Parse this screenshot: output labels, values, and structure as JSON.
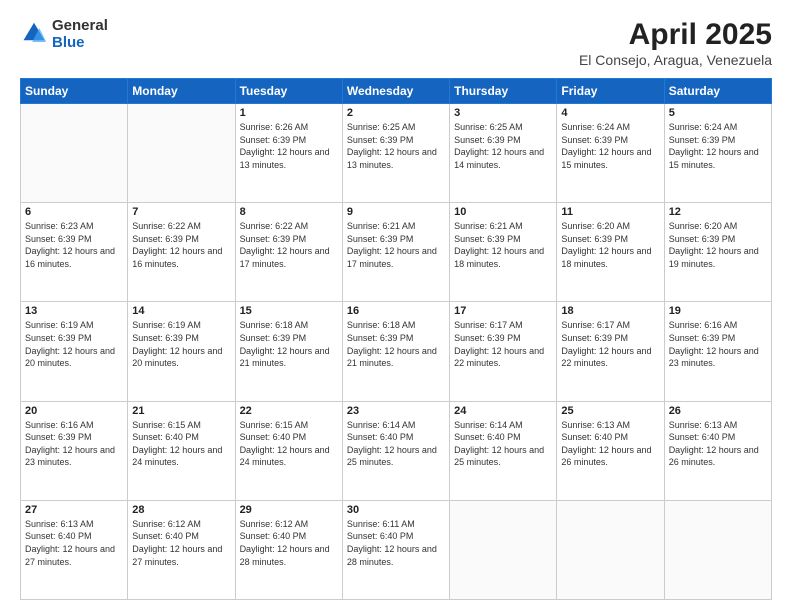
{
  "logo": {
    "general": "General",
    "blue": "Blue"
  },
  "header": {
    "month": "April 2025",
    "location": "El Consejo, Aragua, Venezuela"
  },
  "weekdays": [
    "Sunday",
    "Monday",
    "Tuesday",
    "Wednesday",
    "Thursday",
    "Friday",
    "Saturday"
  ],
  "weeks": [
    [
      {
        "num": "",
        "info": ""
      },
      {
        "num": "",
        "info": ""
      },
      {
        "num": "1",
        "info": "Sunrise: 6:26 AM\nSunset: 6:39 PM\nDaylight: 12 hours and 13 minutes."
      },
      {
        "num": "2",
        "info": "Sunrise: 6:25 AM\nSunset: 6:39 PM\nDaylight: 12 hours and 13 minutes."
      },
      {
        "num": "3",
        "info": "Sunrise: 6:25 AM\nSunset: 6:39 PM\nDaylight: 12 hours and 14 minutes."
      },
      {
        "num": "4",
        "info": "Sunrise: 6:24 AM\nSunset: 6:39 PM\nDaylight: 12 hours and 15 minutes."
      },
      {
        "num": "5",
        "info": "Sunrise: 6:24 AM\nSunset: 6:39 PM\nDaylight: 12 hours and 15 minutes."
      }
    ],
    [
      {
        "num": "6",
        "info": "Sunrise: 6:23 AM\nSunset: 6:39 PM\nDaylight: 12 hours and 16 minutes."
      },
      {
        "num": "7",
        "info": "Sunrise: 6:22 AM\nSunset: 6:39 PM\nDaylight: 12 hours and 16 minutes."
      },
      {
        "num": "8",
        "info": "Sunrise: 6:22 AM\nSunset: 6:39 PM\nDaylight: 12 hours and 17 minutes."
      },
      {
        "num": "9",
        "info": "Sunrise: 6:21 AM\nSunset: 6:39 PM\nDaylight: 12 hours and 17 minutes."
      },
      {
        "num": "10",
        "info": "Sunrise: 6:21 AM\nSunset: 6:39 PM\nDaylight: 12 hours and 18 minutes."
      },
      {
        "num": "11",
        "info": "Sunrise: 6:20 AM\nSunset: 6:39 PM\nDaylight: 12 hours and 18 minutes."
      },
      {
        "num": "12",
        "info": "Sunrise: 6:20 AM\nSunset: 6:39 PM\nDaylight: 12 hours and 19 minutes."
      }
    ],
    [
      {
        "num": "13",
        "info": "Sunrise: 6:19 AM\nSunset: 6:39 PM\nDaylight: 12 hours and 20 minutes."
      },
      {
        "num": "14",
        "info": "Sunrise: 6:19 AM\nSunset: 6:39 PM\nDaylight: 12 hours and 20 minutes."
      },
      {
        "num": "15",
        "info": "Sunrise: 6:18 AM\nSunset: 6:39 PM\nDaylight: 12 hours and 21 minutes."
      },
      {
        "num": "16",
        "info": "Sunrise: 6:18 AM\nSunset: 6:39 PM\nDaylight: 12 hours and 21 minutes."
      },
      {
        "num": "17",
        "info": "Sunrise: 6:17 AM\nSunset: 6:39 PM\nDaylight: 12 hours and 22 minutes."
      },
      {
        "num": "18",
        "info": "Sunrise: 6:17 AM\nSunset: 6:39 PM\nDaylight: 12 hours and 22 minutes."
      },
      {
        "num": "19",
        "info": "Sunrise: 6:16 AM\nSunset: 6:39 PM\nDaylight: 12 hours and 23 minutes."
      }
    ],
    [
      {
        "num": "20",
        "info": "Sunrise: 6:16 AM\nSunset: 6:39 PM\nDaylight: 12 hours and 23 minutes."
      },
      {
        "num": "21",
        "info": "Sunrise: 6:15 AM\nSunset: 6:40 PM\nDaylight: 12 hours and 24 minutes."
      },
      {
        "num": "22",
        "info": "Sunrise: 6:15 AM\nSunset: 6:40 PM\nDaylight: 12 hours and 24 minutes."
      },
      {
        "num": "23",
        "info": "Sunrise: 6:14 AM\nSunset: 6:40 PM\nDaylight: 12 hours and 25 minutes."
      },
      {
        "num": "24",
        "info": "Sunrise: 6:14 AM\nSunset: 6:40 PM\nDaylight: 12 hours and 25 minutes."
      },
      {
        "num": "25",
        "info": "Sunrise: 6:13 AM\nSunset: 6:40 PM\nDaylight: 12 hours and 26 minutes."
      },
      {
        "num": "26",
        "info": "Sunrise: 6:13 AM\nSunset: 6:40 PM\nDaylight: 12 hours and 26 minutes."
      }
    ],
    [
      {
        "num": "27",
        "info": "Sunrise: 6:13 AM\nSunset: 6:40 PM\nDaylight: 12 hours and 27 minutes."
      },
      {
        "num": "28",
        "info": "Sunrise: 6:12 AM\nSunset: 6:40 PM\nDaylight: 12 hours and 27 minutes."
      },
      {
        "num": "29",
        "info": "Sunrise: 6:12 AM\nSunset: 6:40 PM\nDaylight: 12 hours and 28 minutes."
      },
      {
        "num": "30",
        "info": "Sunrise: 6:11 AM\nSunset: 6:40 PM\nDaylight: 12 hours and 28 minutes."
      },
      {
        "num": "",
        "info": ""
      },
      {
        "num": "",
        "info": ""
      },
      {
        "num": "",
        "info": ""
      }
    ]
  ]
}
